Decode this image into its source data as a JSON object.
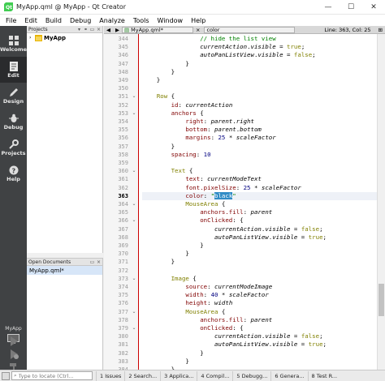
{
  "window": {
    "title": "MyApp.qml @ MyApp - Qt Creator",
    "minimize_glyph": "—",
    "maximize_glyph": "☐",
    "close_glyph": "✕"
  },
  "menubar": {
    "items": [
      "File",
      "Edit",
      "Build",
      "Debug",
      "Analyze",
      "Tools",
      "Window",
      "Help"
    ]
  },
  "modes": {
    "items": [
      {
        "label": "Welcome",
        "icon": "welcome-grid-icon"
      },
      {
        "label": "Edit",
        "icon": "edit-document-icon"
      },
      {
        "label": "Design",
        "icon": "design-pencil-icon"
      },
      {
        "label": "Debug",
        "icon": "debug-bug-icon"
      },
      {
        "label": "Projects",
        "icon": "projects-wrench-icon"
      },
      {
        "label": "Help",
        "icon": "help-question-icon"
      }
    ],
    "target_label": "MyApp"
  },
  "projects_pane": {
    "header": "Projects",
    "tree_items": [
      {
        "label": "MyApp"
      }
    ]
  },
  "open_docs_pane": {
    "header": "Open Documents",
    "items": [
      {
        "label": "MyApp.qml*"
      }
    ]
  },
  "editor": {
    "file_tab": "MyApp.qml*",
    "symbol_combo": "color",
    "line_col": "Line: 363, Col: 25",
    "current_line": 363
  },
  "code_lines": [
    {
      "n": 344,
      "fold": false,
      "html": "                <span class=\"cmt\">// hide the list view</span>"
    },
    {
      "n": 345,
      "fold": false,
      "html": "                <span class=\"it\">currentAction</span>.<span class=\"it\">visible</span> = <span class=\"kw\">true</span>;"
    },
    {
      "n": 346,
      "fold": false,
      "html": "                <span class=\"it\">autoPanListView</span>.<span class=\"it\">visible</span> = <span class=\"kw\">false</span>;"
    },
    {
      "n": 347,
      "fold": false,
      "html": "            }"
    },
    {
      "n": 348,
      "fold": false,
      "html": "        }"
    },
    {
      "n": 349,
      "fold": false,
      "html": "    }"
    },
    {
      "n": 350,
      "fold": false,
      "html": ""
    },
    {
      "n": 351,
      "fold": true,
      "html": "    <span class=\"kw\">Row</span> {"
    },
    {
      "n": 352,
      "fold": false,
      "html": "        <span class=\"prop\">id</span>: <span class=\"it\">currentAction</span>"
    },
    {
      "n": 353,
      "fold": true,
      "html": "        <span class=\"prop\">anchors</span> {"
    },
    {
      "n": 354,
      "fold": false,
      "html": "            <span class=\"prop\">right</span>: <span class=\"it\">parent</span>.<span class=\"it\">right</span>"
    },
    {
      "n": 355,
      "fold": false,
      "html": "            <span class=\"prop\">bottom</span>: <span class=\"it\">parent</span>.<span class=\"it\">bottom</span>"
    },
    {
      "n": 356,
      "fold": false,
      "html": "            <span class=\"prop\">margins</span>: <span class=\"num\">25</span> * <span class=\"it\">scaleFactor</span>"
    },
    {
      "n": 357,
      "fold": false,
      "html": "        }"
    },
    {
      "n": 358,
      "fold": false,
      "html": "        <span class=\"prop\">spacing</span>: <span class=\"num\">10</span>"
    },
    {
      "n": 359,
      "fold": false,
      "html": ""
    },
    {
      "n": 360,
      "fold": true,
      "html": "        <span class=\"kw\">Text</span> {"
    },
    {
      "n": 361,
      "fold": false,
      "html": "            <span class=\"prop\">text</span>: <span class=\"it\">currentModeText</span>"
    },
    {
      "n": 362,
      "fold": false,
      "html": "            <span class=\"prop\">font.pixelSize</span>: <span class=\"num\">25</span> * <span class=\"it\">scaleFactor</span>"
    },
    {
      "n": 363,
      "fold": false,
      "html": "            <span class=\"prop\">color</span>: <span class=\"str\">\"<span class=\"sel\">black</span>\"</span>"
    },
    {
      "n": 364,
      "fold": true,
      "html": "            <span class=\"kw\">MouseArea</span> {"
    },
    {
      "n": 365,
      "fold": false,
      "html": "                <span class=\"prop\">anchors.fill</span>: <span class=\"it\">parent</span>"
    },
    {
      "n": 366,
      "fold": true,
      "html": "                <span class=\"prop\">onClicked</span>: {"
    },
    {
      "n": 367,
      "fold": false,
      "html": "                    <span class=\"it\">currentAction</span>.<span class=\"it\">visible</span> = <span class=\"kw\">false</span>;"
    },
    {
      "n": 368,
      "fold": false,
      "html": "                    <span class=\"it\">autoPanListView</span>.<span class=\"it\">visible</span> = <span class=\"kw\">true</span>;"
    },
    {
      "n": 369,
      "fold": false,
      "html": "                }"
    },
    {
      "n": 370,
      "fold": false,
      "html": "            }"
    },
    {
      "n": 371,
      "fold": false,
      "html": "        }"
    },
    {
      "n": 372,
      "fold": false,
      "html": ""
    },
    {
      "n": 373,
      "fold": true,
      "html": "        <span class=\"kw\">Image</span> {"
    },
    {
      "n": 374,
      "fold": false,
      "html": "            <span class=\"prop\">source</span>: <span class=\"it\">currentModeImage</span>"
    },
    {
      "n": 375,
      "fold": false,
      "html": "            <span class=\"prop\">width</span>: <span class=\"num\">40</span> * <span class=\"it\">scaleFactor</span>"
    },
    {
      "n": 376,
      "fold": false,
      "html": "            <span class=\"prop\">height</span>: <span class=\"it\">width</span>"
    },
    {
      "n": 377,
      "fold": true,
      "html": "            <span class=\"kw\">MouseArea</span> {"
    },
    {
      "n": 378,
      "fold": false,
      "html": "                <span class=\"prop\">anchors.fill</span>: <span class=\"it\">parent</span>"
    },
    {
      "n": 379,
      "fold": true,
      "html": "                <span class=\"prop\">onClicked</span>: {"
    },
    {
      "n": 380,
      "fold": false,
      "html": "                    <span class=\"it\">currentAction</span>.<span class=\"it\">visible</span> = <span class=\"kw\">false</span>;"
    },
    {
      "n": 381,
      "fold": false,
      "html": "                    <span class=\"it\">autoPanListView</span>.<span class=\"it\">visible</span> = <span class=\"kw\">true</span>;"
    },
    {
      "n": 382,
      "fold": false,
      "html": "                }"
    },
    {
      "n": 383,
      "fold": false,
      "html": "            }"
    },
    {
      "n": 384,
      "fold": false,
      "html": "        }"
    }
  ],
  "statusbar": {
    "locator_placeholder": "Type to locate (Ctrl...",
    "panes": [
      "1 Issues",
      "2 Search...",
      "3 Applica...",
      "4 Compil...",
      "5 Debugg...",
      "6 Genera...",
      "8 Test R..."
    ]
  }
}
